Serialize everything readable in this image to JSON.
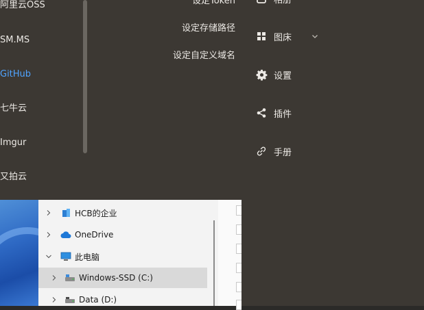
{
  "image_bed_list": {
    "items": [
      {
        "label": "阿里云OSS",
        "active": false
      },
      {
        "label": "SM.MS",
        "active": false
      },
      {
        "label": "GitHub",
        "active": true
      },
      {
        "label": "七牛云",
        "active": false
      },
      {
        "label": "Imgur",
        "active": false
      },
      {
        "label": "又拍云",
        "active": false
      }
    ]
  },
  "config_links": {
    "token": "设定Token",
    "storage_path": "设定存储路径",
    "custom_domain": "设定自定义域名"
  },
  "nav": {
    "items": [
      {
        "label": "相册",
        "icon": "album-icon"
      },
      {
        "label": "图床",
        "icon": "grid-icon",
        "has_submenu": true
      },
      {
        "label": "设置",
        "icon": "gear-icon"
      },
      {
        "label": "插件",
        "icon": "share-icon"
      },
      {
        "label": "手册",
        "icon": "link-icon"
      }
    ]
  },
  "explorer": {
    "tree": [
      {
        "label": "HCB的企业",
        "icon": "building-icon",
        "expanded": false
      },
      {
        "label": "OneDrive",
        "icon": "cloud-icon",
        "expanded": false
      },
      {
        "label": "此电脑",
        "icon": "computer-icon",
        "expanded": true
      },
      {
        "label": "Windows-SSD (C:)",
        "icon": "drive-icon",
        "selected": true
      },
      {
        "label": "Data (D:)",
        "icon": "drive-icon"
      }
    ]
  },
  "colors": {
    "panel_bg": "#3c3833",
    "active_link": "#4fa3ff",
    "text": "#ece9e5"
  }
}
